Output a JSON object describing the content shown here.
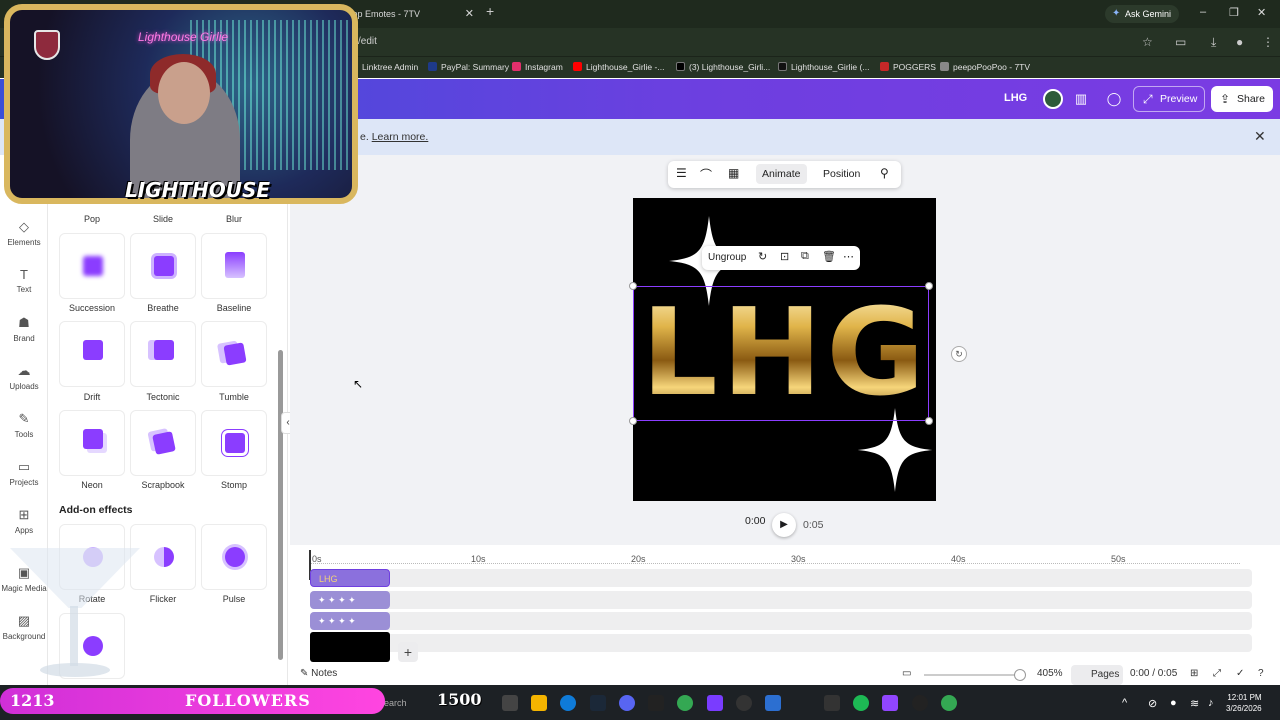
{
  "browser": {
    "tab_title": "Top Emotes - 7TV",
    "url": "/edit",
    "ask_gemini": "Ask Gemini",
    "bookmarks": [
      "Linktree Admin",
      "PayPal: Summary",
      "Instagram",
      "Lighthouse_Girlie -...",
      "(3) Lighthouse_Girli...",
      "Lighthouse_Girlie (...",
      "POGGERS",
      "peepoPooPoo - 7TV"
    ]
  },
  "header": {
    "title": "LHG",
    "preview": "Preview",
    "share": "Share"
  },
  "banner": {
    "text": "e.",
    "link": "Learn more."
  },
  "rail": {
    "items": [
      "Elements",
      "Text",
      "Brand",
      "Uploads",
      "Tools",
      "Projects",
      "Apps",
      "Magic Media",
      "Background"
    ]
  },
  "panel": {
    "top_labels": [
      "Pop",
      "Slide",
      "Blur"
    ],
    "row1": [
      "Succession",
      "Breathe",
      "Baseline"
    ],
    "row2": [
      "Drift",
      "Tectonic",
      "Tumble"
    ],
    "row3": [
      "Neon",
      "Scrapbook",
      "Stomp"
    ],
    "addon_title": "Add-on effects",
    "row4": [
      "Rotate",
      "Flicker",
      "Pulse"
    ]
  },
  "toolbar": {
    "animate": "Animate",
    "position": "Position"
  },
  "canvas": {
    "text": "LHG",
    "ungroup": "Ungroup"
  },
  "player": {
    "current": "0:00",
    "end": "0:05"
  },
  "timeline": {
    "marks": [
      "0s",
      "10s",
      "20s",
      "30s",
      "40s",
      "50s"
    ],
    "clip_label": "LHG"
  },
  "bottom": {
    "notes": "Notes",
    "zoom": "405%",
    "pages": "Pages",
    "time": "0:00 / 0:05"
  },
  "taskbar": {
    "search": "Search",
    "time": "12:01 PM",
    "date": "3/26/2026"
  },
  "stream": {
    "sign": "Lighthouse Girlie",
    "logo": "LIGHTHOUSE",
    "followers_count": "1213",
    "followers_label": "FOLLOWERS",
    "goal": "1500"
  }
}
